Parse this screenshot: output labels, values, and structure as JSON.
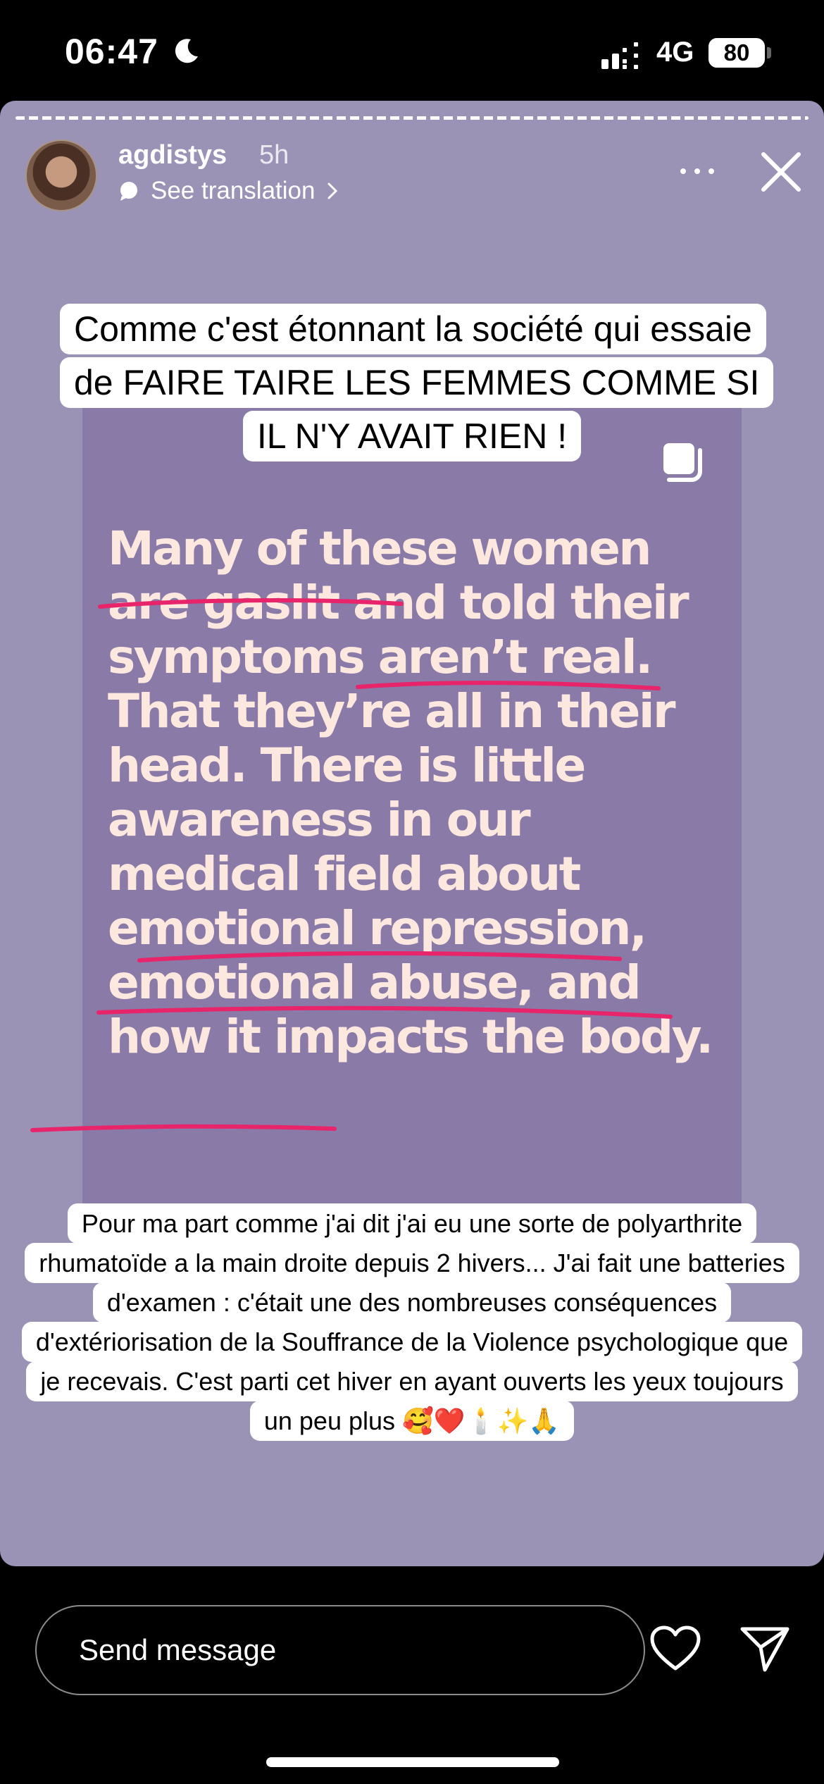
{
  "status_bar": {
    "time": "06:47",
    "network": "4G",
    "battery": "80"
  },
  "story": {
    "username": "agdistys",
    "time_ago": "5h",
    "see_translation": "See translation",
    "background_color": "#9a93b6",
    "top_caption": "Comme c'est étonnant la société qui essaie de FAIRE TAIRE LES FEMMES COMME SI IL N'Y AVAIT RIEN !",
    "post_text": "Many of these women are gaslit and told their symptoms aren’t real. That they’re all in their head. There is little awareness in our medical field about emotional repression, emotional abuse, and how it impacts the body.",
    "bottom_caption": "Pour ma part comme j'ai dit j'ai eu une sorte de polyarthrite rhumatoïde a la main droite depuis 2 hivers... J'ai fait une batteries d'examen : c'était une des nombreuses conséquences d'extériorisation de la Souffrance de la Violence psychologique  que je recevais. C'est parti cet hiver en ayant ouverts les yeux toujours un peu plus 🥰❤️🕯️✨🙏",
    "underline_color": "#e8256a"
  },
  "footer": {
    "message_placeholder": "Send message"
  },
  "icons": [
    "moon-icon",
    "signal-icon",
    "chat-bubble-icon",
    "chevron-right-icon",
    "more-icon",
    "close-icon",
    "copy-icon",
    "heart-icon",
    "send-icon"
  ]
}
